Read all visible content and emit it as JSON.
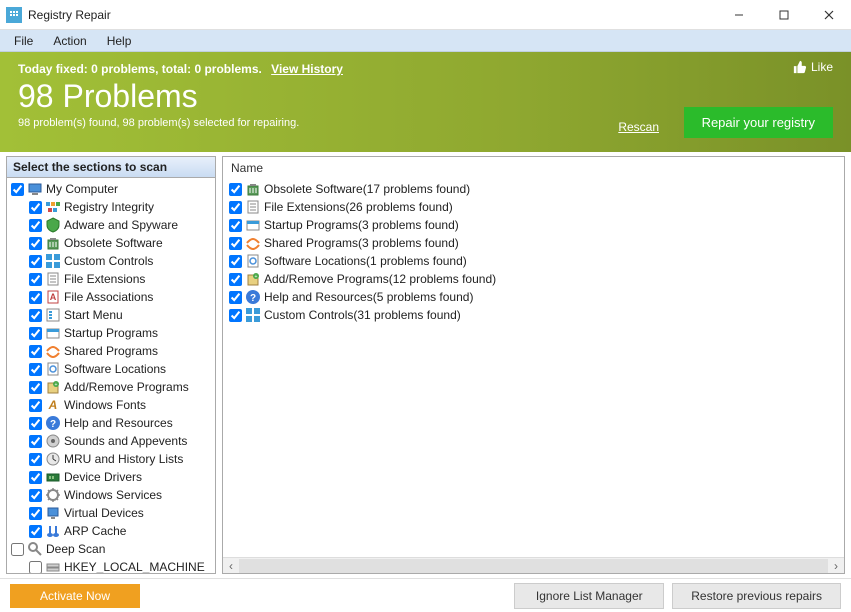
{
  "window": {
    "title": "Registry Repair"
  },
  "menubar": {
    "items": [
      "File",
      "Action",
      "Help"
    ]
  },
  "header": {
    "status_prefix": "Today fixed: 0 problems, total: 0 problems.",
    "view_history": "View History",
    "big_title": "98 Problems",
    "subtitle": "98 problem(s) found, 98 problem(s) selected for repairing.",
    "like": "Like",
    "rescan": "Rescan",
    "repair_btn": "Repair your registry"
  },
  "left": {
    "title": "Select the sections to scan",
    "tree": [
      {
        "level": 0,
        "checked": true,
        "icon": "computer",
        "label": "My Computer"
      },
      {
        "level": 1,
        "checked": true,
        "icon": "integrity",
        "label": "Registry Integrity"
      },
      {
        "level": 1,
        "checked": true,
        "icon": "adware",
        "label": "Adware and Spyware"
      },
      {
        "level": 1,
        "checked": true,
        "icon": "obsolete",
        "label": "Obsolete Software"
      },
      {
        "level": 1,
        "checked": true,
        "icon": "controls",
        "label": "Custom Controls"
      },
      {
        "level": 1,
        "checked": true,
        "icon": "fileext",
        "label": "File Extensions"
      },
      {
        "level": 1,
        "checked": true,
        "icon": "fileassoc",
        "label": "File Associations"
      },
      {
        "level": 1,
        "checked": true,
        "icon": "startmenu",
        "label": "Start Menu"
      },
      {
        "level": 1,
        "checked": true,
        "icon": "startup",
        "label": "Startup Programs"
      },
      {
        "level": 1,
        "checked": true,
        "icon": "shared",
        "label": "Shared Programs"
      },
      {
        "level": 1,
        "checked": true,
        "icon": "swloc",
        "label": "Software Locations"
      },
      {
        "level": 1,
        "checked": true,
        "icon": "addremove",
        "label": "Add/Remove Programs"
      },
      {
        "level": 1,
        "checked": true,
        "icon": "fonts",
        "label": "Windows Fonts"
      },
      {
        "level": 1,
        "checked": true,
        "icon": "help",
        "label": "Help and Resources"
      },
      {
        "level": 1,
        "checked": true,
        "icon": "sounds",
        "label": "Sounds and Appevents"
      },
      {
        "level": 1,
        "checked": true,
        "icon": "mru",
        "label": "MRU and History Lists"
      },
      {
        "level": 1,
        "checked": true,
        "icon": "drivers",
        "label": "Device Drivers"
      },
      {
        "level": 1,
        "checked": true,
        "icon": "services",
        "label": "Windows Services"
      },
      {
        "level": 1,
        "checked": true,
        "icon": "virtual",
        "label": "Virtual Devices"
      },
      {
        "level": 1,
        "checked": true,
        "icon": "arp",
        "label": "ARP Cache"
      },
      {
        "level": 0,
        "checked": false,
        "icon": "deepscan",
        "label": "Deep Scan"
      },
      {
        "level": 1,
        "checked": false,
        "icon": "hkey",
        "label": "HKEY_LOCAL_MACHINE"
      }
    ]
  },
  "right": {
    "header": "Name",
    "rows": [
      {
        "checked": true,
        "icon": "obsolete",
        "label": "Obsolete Software(17 problems found)"
      },
      {
        "checked": true,
        "icon": "fileext",
        "label": "File Extensions(26 problems found)"
      },
      {
        "checked": true,
        "icon": "startup",
        "label": "Startup Programs(3 problems found)"
      },
      {
        "checked": true,
        "icon": "shared",
        "label": "Shared Programs(3 problems found)"
      },
      {
        "checked": true,
        "icon": "swloc",
        "label": "Software Locations(1 problems found)"
      },
      {
        "checked": true,
        "icon": "addremove",
        "label": "Add/Remove Programs(12 problems found)"
      },
      {
        "checked": true,
        "icon": "help",
        "label": "Help and Resources(5 problems found)"
      },
      {
        "checked": true,
        "icon": "controls",
        "label": "Custom Controls(31 problems found)"
      }
    ]
  },
  "footer": {
    "activate": "Activate Now",
    "ignore": "Ignore List Manager",
    "restore": "Restore previous repairs"
  }
}
